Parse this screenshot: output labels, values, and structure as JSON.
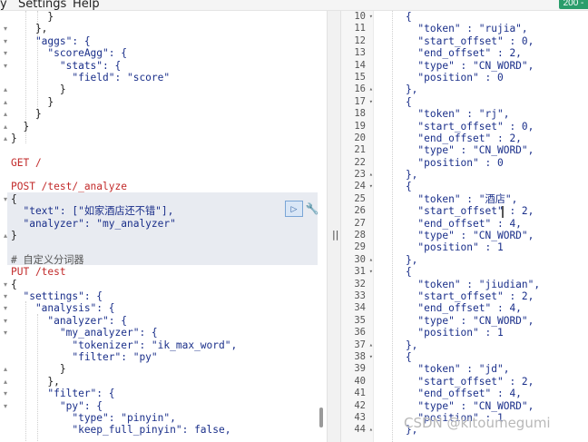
{
  "menu": {
    "view_label": "y",
    "settings_label": "Settings",
    "help_label": "Help"
  },
  "status_badge": "200 - ",
  "left_pane": {
    "lines": [
      {
        "t": "      }",
        "c": "p"
      },
      {
        "t": "    },",
        "c": "p"
      },
      {
        "t": "    \"aggs\": {",
        "c": "k"
      },
      {
        "t": "      \"scoreAgg\": {",
        "c": "k"
      },
      {
        "t": "        \"stats\": {",
        "c": "k"
      },
      {
        "t": "          \"field\": \"score\"",
        "c": "k"
      },
      {
        "t": "        }",
        "c": "p"
      },
      {
        "t": "      }",
        "c": "p"
      },
      {
        "t": "    }",
        "c": "p"
      },
      {
        "t": "  }",
        "c": "p"
      },
      {
        "t": "}",
        "c": "p"
      },
      {
        "t": "",
        "c": "p"
      },
      {
        "t": "GET /",
        "c": "m"
      },
      {
        "t": "",
        "c": "p"
      },
      {
        "t": "POST /test/_analyze",
        "c": "m"
      },
      {
        "t": "{",
        "c": "p"
      },
      {
        "t": "  \"text\": [\"如家酒店还不错\"],",
        "c": "k"
      },
      {
        "t": "  \"analyzer\": \"my_analyzer\"",
        "c": "k"
      },
      {
        "t": "}",
        "c": "p"
      },
      {
        "t": "",
        "c": "p"
      },
      {
        "t": "# 自定义分词器",
        "c": "c"
      },
      {
        "t": "PUT /test",
        "c": "m"
      },
      {
        "t": "{",
        "c": "p"
      },
      {
        "t": "  \"settings\": {",
        "c": "k"
      },
      {
        "t": "    \"analysis\": {",
        "c": "k"
      },
      {
        "t": "      \"analyzer\": {",
        "c": "k"
      },
      {
        "t": "        \"my_analyzer\": {",
        "c": "k"
      },
      {
        "t": "          \"tokenizer\": \"ik_max_word\",",
        "c": "k"
      },
      {
        "t": "          \"filter\": \"py\"",
        "c": "k"
      },
      {
        "t": "        }",
        "c": "p"
      },
      {
        "t": "      },",
        "c": "p"
      },
      {
        "t": "      \"filter\": {",
        "c": "k"
      },
      {
        "t": "        \"py\": {",
        "c": "k"
      },
      {
        "t": "          \"type\": \"pinyin\",",
        "c": "k"
      },
      {
        "t": "          \"keep_full_pinyin\": false,",
        "c": "k"
      }
    ],
    "fold_marks": [
      "",
      "▾",
      "▾",
      "▾",
      "▾",
      "",
      "▴",
      "▴",
      "▴",
      "▴",
      "▴",
      "",
      "",
      "",
      "",
      "▾",
      "",
      "",
      "▴",
      "",
      "",
      "",
      "▾",
      "▾",
      "▾",
      "▾",
      "▾",
      "",
      "",
      "▴",
      "▴",
      "▾",
      "▾",
      "",
      ""
    ]
  },
  "right_pane": {
    "line_numbers": [
      "10",
      "11",
      "12",
      "13",
      "14",
      "15",
      "16",
      "17",
      "18",
      "19",
      "20",
      "21",
      "22",
      "23",
      "24",
      "25",
      "26",
      "27",
      "28",
      "29",
      "30",
      "31",
      "32",
      "33",
      "34",
      "35",
      "36",
      "37",
      "38",
      "39",
      "40",
      "41",
      "42",
      "43",
      "44"
    ],
    "fold_marks": [
      "▾",
      "",
      "",
      "",
      "",
      "",
      "▴",
      "▾",
      "",
      "",
      "",
      "",
      "",
      "▴",
      "▾",
      "",
      "",
      "",
      "",
      "",
      "▴",
      "▾",
      "",
      "",
      "",
      "",
      "",
      "▴",
      "▾",
      "",
      "",
      "",
      "",
      "",
      "▴"
    ],
    "lines": [
      "    {",
      "      \"token\" : \"rujia\",",
      "      \"start_offset\" : 0,",
      "      \"end_offset\" : 2,",
      "      \"type\" : \"CN_WORD\",",
      "      \"position\" : 0",
      "    },",
      "    {",
      "      \"token\" : \"rj\",",
      "      \"start_offset\" : 0,",
      "      \"end_offset\" : 2,",
      "      \"type\" : \"CN_WORD\",",
      "      \"position\" : 0",
      "    },",
      "    {",
      "      \"token\" : \"酒店\",",
      "      \"start_offset\" : 2,",
      "      \"end_offset\" : 4,",
      "      \"type\" : \"CN_WORD\",",
      "      \"position\" : 1",
      "    },",
      "    {",
      "      \"token\" : \"jiudian\",",
      "      \"start_offset\" : 2,",
      "      \"end_offset\" : 4,",
      "      \"type\" : \"CN_WORD\",",
      "      \"position\" : 1",
      "    },",
      "    {",
      "      \"token\" : \"jd\",",
      "      \"start_offset\" : 2,",
      "      \"end_offset\" : 4,",
      "      \"type\" : \"CN_WORD\",",
      "      \"position\" : 1",
      "    },"
    ]
  },
  "divider_handle": "||",
  "watermark": "CSDN @kitoumegumi",
  "colors": {
    "key": "#1a2f8a",
    "string": "#2a7a2a",
    "method": "#c22a2a",
    "selection": "#e8ebf1"
  }
}
